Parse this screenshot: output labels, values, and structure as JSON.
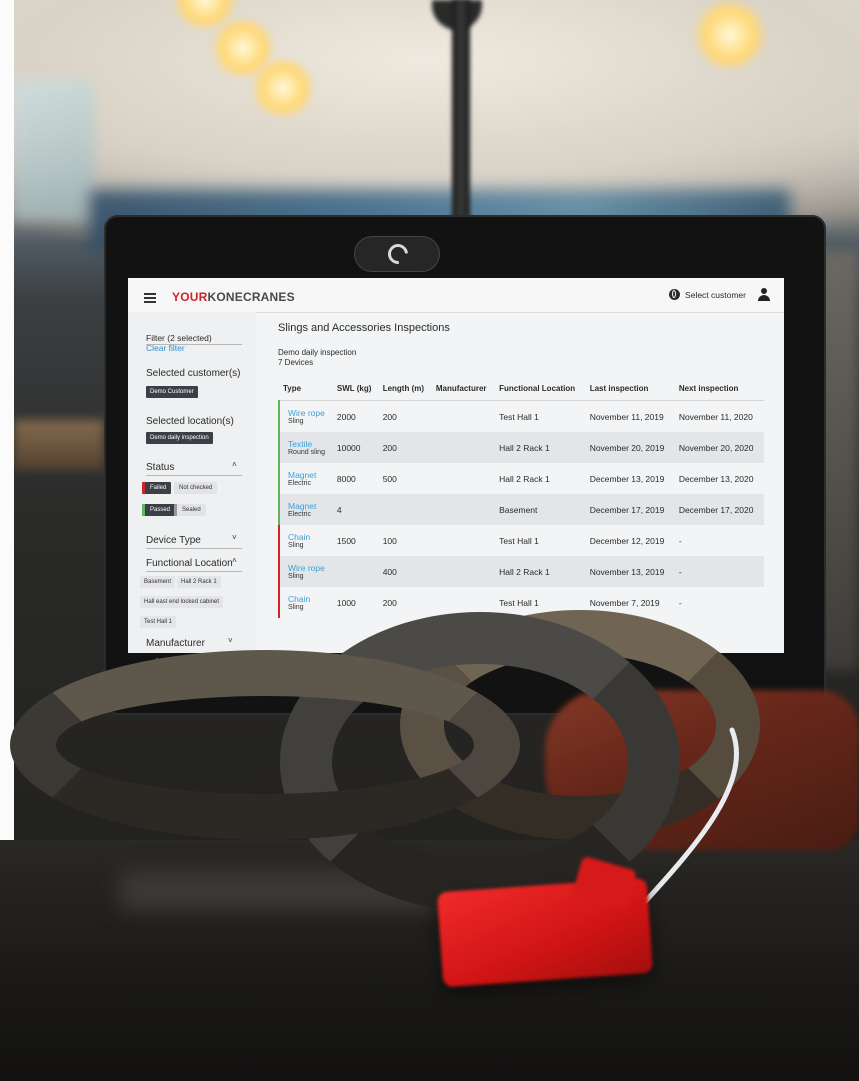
{
  "app": {
    "logo_part1": "YOUR",
    "logo_part2": "KONECRANES",
    "select_customer": "Select customer"
  },
  "sidebar": {
    "filter_title": "Filter (2 selected)",
    "clear_filter": "Clear filter",
    "selected_customers_label": "Selected customer(s)",
    "selected_customer_chip": "Demo Customer",
    "selected_locations_label": "Selected location(s)",
    "selected_location_chip": "Demo daily inspection",
    "status_label": "Status",
    "status_failed": "Failed",
    "status_not_checked": "Not checked",
    "status_passed": "Passed",
    "status_sealed": "Sealed",
    "device_type_label": "Device Type",
    "functional_location_label": "Functional Location",
    "locations": [
      "Basement",
      "Hall 2 Rack 1",
      "Hall east end locked cabinet",
      "Test Hall 1"
    ],
    "manufacturer_label": "Manufacturer"
  },
  "main": {
    "page_title": "Slings and Accessories Inspections",
    "inspection_name": "Demo daily inspection",
    "device_count": "7 Devices",
    "columns": [
      "Type",
      "SWL (kg)",
      "Length (m)",
      "Manufacturer",
      "Functional Location",
      "Last inspection",
      "Next inspection"
    ],
    "rows": [
      {
        "type": "Wire rope",
        "subtype": "Sling",
        "swl": "2000",
        "length": "200",
        "manufacturer": "",
        "location": "Test Hall 1",
        "last": "November 11, 2019",
        "next": "November 11, 2020",
        "status": "passed"
      },
      {
        "type": "Textile",
        "subtype": "Round sling",
        "swl": "10000",
        "length": "200",
        "manufacturer": "",
        "location": "Hall 2 Rack 1",
        "last": "November 20, 2019",
        "next": "November 20, 2020",
        "status": "passed"
      },
      {
        "type": "Magnet",
        "subtype": "Electric",
        "swl": "8000",
        "length": "500",
        "manufacturer": "",
        "location": "Hall 2 Rack 1",
        "last": "December 13, 2019",
        "next": "December 13, 2020",
        "status": "passed"
      },
      {
        "type": "Magnet",
        "subtype": "Electric",
        "swl": "4",
        "length": "",
        "manufacturer": "",
        "location": "Basement",
        "last": "December 17, 2019",
        "next": "December 17, 2020",
        "status": "passed"
      },
      {
        "type": "Chain",
        "subtype": "Sling",
        "swl": "1500",
        "length": "100",
        "manufacturer": "",
        "location": "Test Hall 1",
        "last": "December 12, 2019",
        "next": "-",
        "status": "failed"
      },
      {
        "type": "Wire rope",
        "subtype": "Sling",
        "swl": "",
        "length": "400",
        "manufacturer": "",
        "location": "Hall 2 Rack 1",
        "last": "November 13, 2019",
        "next": "-",
        "status": "failed"
      },
      {
        "type": "Chain",
        "subtype": "Sling",
        "swl": "1000",
        "length": "200",
        "manufacturer": "",
        "location": "Test Hall 1",
        "last": "November 7, 2019",
        "next": "-",
        "status": "failed"
      }
    ]
  },
  "colors": {
    "brand_red": "#d0232a",
    "link_blue": "#3da0d6",
    "passed_green": "#5cb85c",
    "red_tag": "#e01d1d"
  }
}
